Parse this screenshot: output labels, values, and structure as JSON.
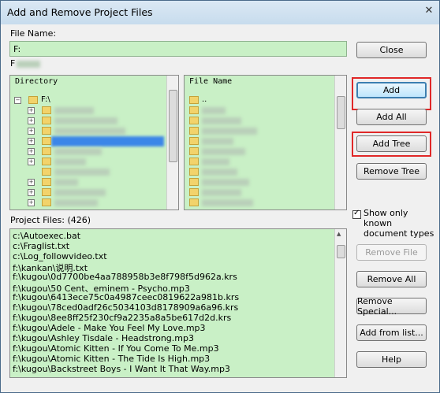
{
  "window": {
    "title": "Add and Remove Project Files"
  },
  "file_name": {
    "label": "File Name:",
    "value": "F:"
  },
  "folders_label": "F",
  "directory_panel": {
    "header": "Directory",
    "root": "F:\\"
  },
  "file_panel": {
    "header": "File Name",
    "first": ".."
  },
  "project_files": {
    "label": "Project Files: (426)",
    "items": [
      "c:\\Autoexec.bat",
      "c:\\Fraglist.txt",
      "c:\\Log_followvideo.txt",
      "f:\\kankan\\说明.txt",
      "f:\\kugou\\0d7700be4aa788958b3e8f798f5d962a.krs",
      "f:\\kugou\\50 Cent、eminem - Psycho.mp3",
      "f:\\kugou\\6413ece75c0a4987ceec0819622a981b.krs",
      "f:\\kugou\\78ced0adf26c5034103d8178909a6a96.krs",
      "f:\\kugou\\8ee8ff25f230cf9a2235a8a5be617d2d.krs",
      "f:\\kugou\\Adele - Make You Feel My Love.mp3",
      "f:\\kugou\\Ashley Tisdale - Headstrong.mp3",
      "f:\\kugou\\Atomic Kitten - If You Come To Me.mp3",
      "f:\\kugou\\Atomic Kitten - The Tide Is High.mp3",
      "f:\\kugou\\Backstreet Boys - I Want It That Way.mp3"
    ]
  },
  "buttons": {
    "close": "Close",
    "add": "Add",
    "add_all": "Add All",
    "add_tree": "Add Tree",
    "remove_tree": "Remove Tree",
    "remove_file": "Remove File",
    "remove_all": "Remove All",
    "remove_special": "Remove Special...",
    "add_from_list": "Add from list...",
    "help": "Help"
  },
  "show_known": {
    "label": "Show only known document types",
    "checked": true
  },
  "colors": {
    "field_bg": "#c9f0c6",
    "highlight": "#e02828",
    "selection": "#3b86e8"
  }
}
